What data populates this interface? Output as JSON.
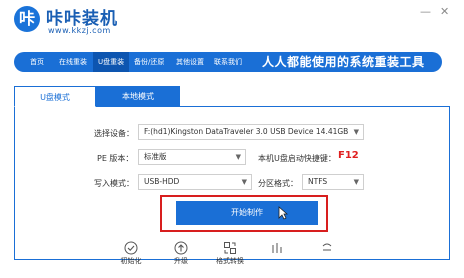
{
  "header": {
    "logo_glyph": "咔",
    "app_title": "咔咔装机",
    "url": "www.kkzj.com",
    "minimize": "—",
    "close": "✕"
  },
  "nav": {
    "items": [
      {
        "label": "首页"
      },
      {
        "label": "在线重装"
      },
      {
        "label": "U盘重装"
      },
      {
        "label": "备份/还原"
      },
      {
        "label": "其他设置"
      },
      {
        "label": "联系我们"
      }
    ],
    "active_index": 2,
    "slogan": "人人都能使用的系统重装工具"
  },
  "tabs": [
    {
      "label": "U盘模式"
    },
    {
      "label": "本地模式"
    }
  ],
  "form": {
    "device_label": "选择设备：",
    "device_value": "F:(hd1)Kingston DataTraveler 3.0 USB Device 14.41GB",
    "pe_label": "PE 版本：",
    "pe_value": "标准版",
    "hotkey_label": "本机U盘启动快捷键：",
    "hotkey_value": "F12",
    "write_mode_label": "写入模式：",
    "write_mode_value": "USB-HDD",
    "partition_label": "分区格式：",
    "partition_value": "NTFS"
  },
  "start_button": "开始制作",
  "bottom_tools": [
    {
      "label": "初始化",
      "icon": "check-circle-icon"
    },
    {
      "label": "升级",
      "icon": "upload-arrow-icon"
    },
    {
      "label": "格式转换",
      "icon": "format-convert-icon"
    },
    {
      "label": "",
      "icon": "partial-icon"
    },
    {
      "label": "",
      "icon": "partial-icon"
    }
  ],
  "colors": {
    "brand_blue": "#1a6fd6",
    "highlight_red": "#d81e1e",
    "hotkey_red": "#e02020"
  }
}
